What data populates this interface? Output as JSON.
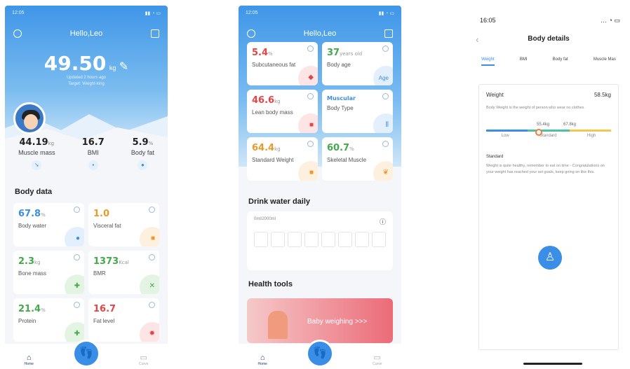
{
  "s1": {
    "time": "12:05",
    "greeting": "Hello,Leo",
    "weight": "49.50",
    "unit": "kg",
    "updated": "Updated 2 hours ago",
    "target": "Target: Weight-king",
    "stats": [
      {
        "v": "44.19",
        "u": "kg",
        "l": "Muscle mass"
      },
      {
        "v": "16.7",
        "u": "",
        "l": "BMI"
      },
      {
        "v": "5.9",
        "u": "%",
        "l": "Body fat"
      }
    ],
    "section": "Body data",
    "cards": [
      {
        "v": "67.8",
        "u": "%",
        "l": "Body water"
      },
      {
        "v": "1.0",
        "u": "",
        "l": "Visceral fat"
      },
      {
        "v": "2.3",
        "u": "kg",
        "l": "Bone mass"
      },
      {
        "v": "1373",
        "u": "Kcal",
        "l": "BMR"
      },
      {
        "v": "21.4",
        "u": "%",
        "l": "Protein"
      },
      {
        "v": "16.7",
        "u": "",
        "l": "Fat level"
      }
    ],
    "tabs": [
      "Home",
      "Curve"
    ]
  },
  "s2": {
    "time": "12:05",
    "greeting": "Hello,Leo",
    "cards": [
      {
        "v": "5.4",
        "u": "%",
        "l": "Subcutaneous fat"
      },
      {
        "v": "37",
        "u": "years old",
        "l": "Body age",
        "tag": "Age"
      },
      {
        "v": "46.6",
        "u": "kg",
        "l": "Lean body mass"
      },
      {
        "v": "Muscular",
        "u": "",
        "l": "Body Type"
      },
      {
        "v": "64.4",
        "u": "kg",
        "l": "Standard Weight"
      },
      {
        "v": "60.7",
        "u": "%",
        "l": "Skeletal Muscle"
      }
    ],
    "drink_title": "Drink water daily",
    "drink_value": "0ml/2000ml",
    "tools_title": "Health tools",
    "banner": "Baby weighing >>>",
    "tabs": [
      "Home",
      "Curve"
    ]
  },
  "s3": {
    "time": "16:05",
    "title": "Body details",
    "tabs": [
      "Weight",
      "BMI",
      "Body fat",
      "Muscle Mas"
    ],
    "item": "Weight",
    "value": "58.5kg",
    "desc": "Body Weight is the weight of person who wear no clothes.",
    "scale_nums": [
      "55.4kg",
      "67.8kg"
    ],
    "scale_labels": [
      "Low",
      "Standard",
      "High"
    ],
    "status": "Standard",
    "advice": "Weight is quite healthy, remember to eat on time - Congratulations on your weight has reached your set goals, keep going on like this."
  }
}
